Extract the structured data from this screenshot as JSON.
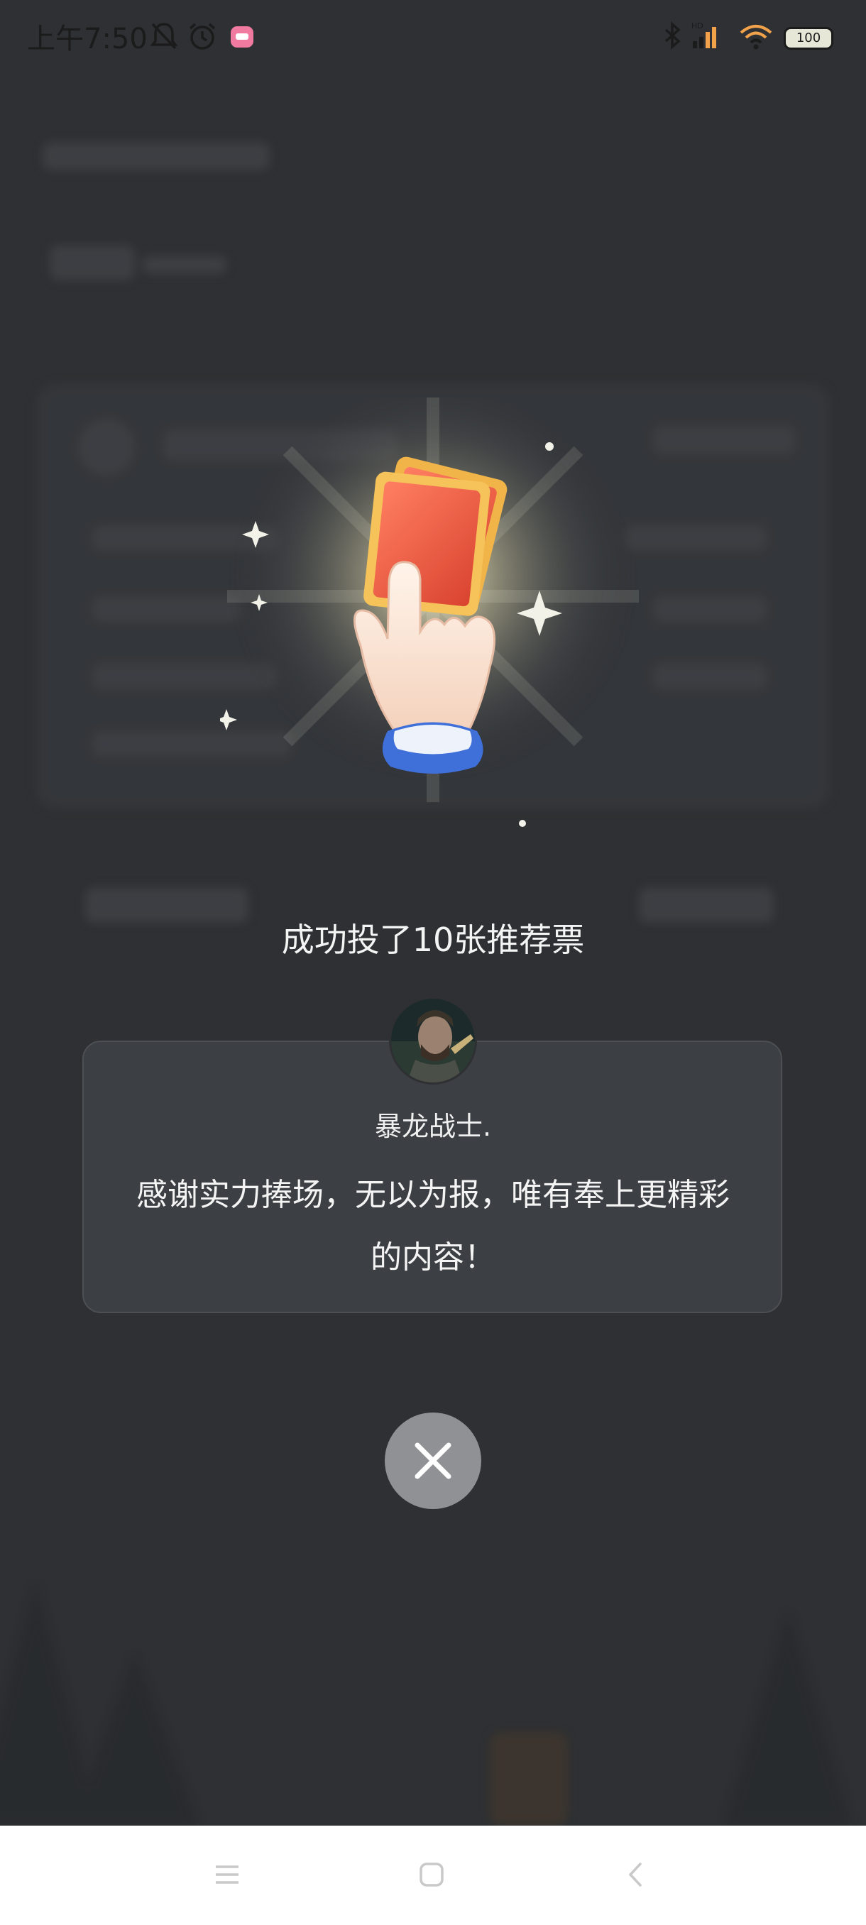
{
  "status_bar": {
    "time": "上午7:50",
    "battery": "100",
    "icons": [
      "mute-bell-icon",
      "alarm-clock-icon",
      "app-notification-icon",
      "bluetooth-icon",
      "signal-hd-icon",
      "wifi-icon",
      "battery-icon"
    ]
  },
  "reward": {
    "message": "成功投了10张推荐票",
    "icon": "hand-holding-tickets-icon"
  },
  "author": {
    "name": "暴龙战士.",
    "thanks": "感谢实力捧场，无以为报，唯有奉上更精彩的内容！"
  },
  "close": {
    "icon": "close-icon"
  },
  "nav": {
    "icons": [
      "menu-icon",
      "home-icon",
      "back-icon"
    ]
  },
  "colors": {
    "overlay": "#2e3033",
    "card": "#3c3f43",
    "close_button": "#8f9194",
    "ticket": "#e8503a",
    "cuff": "#3f6fd8"
  }
}
